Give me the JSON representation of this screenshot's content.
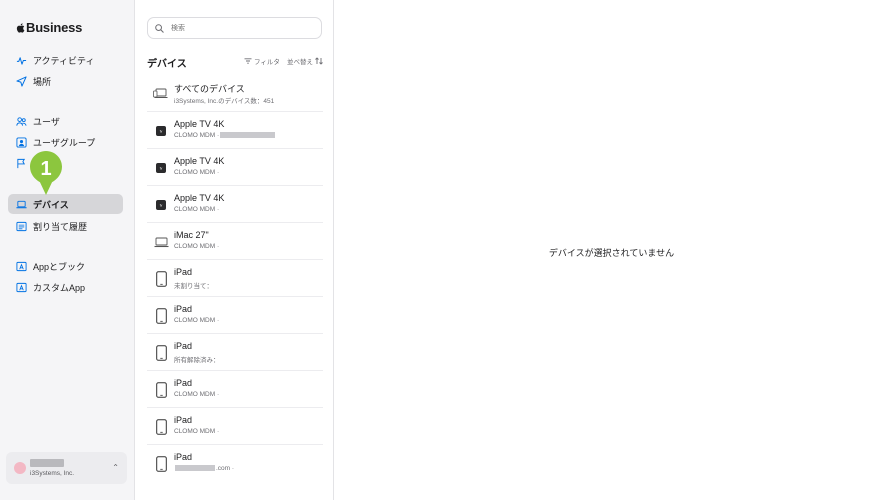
{
  "sidebar": {
    "brand": "Business",
    "items": [
      {
        "label": "アクティビティ",
        "icon": "activity-icon"
      },
      {
        "label": "場所",
        "icon": "location-arrow-icon"
      },
      {
        "label": "ユーザ",
        "icon": "users-icon"
      },
      {
        "label": "ユーザグループ",
        "icon": "user-group-icon"
      },
      {
        "label": "",
        "icon": "flag-icon"
      },
      {
        "label": "デバイス",
        "icon": "laptop-icon",
        "active": true
      },
      {
        "label": "割り当て履歴",
        "icon": "list-icon"
      },
      {
        "label": "Appとブック",
        "icon": "app-store-icon"
      },
      {
        "label": "カスタムApp",
        "icon": "custom-app-icon"
      }
    ],
    "account": {
      "org": "i3Systems, Inc."
    }
  },
  "callout": {
    "number": "1",
    "color": "#8cc63e"
  },
  "list": {
    "search_placeholder": "検索",
    "title": "デバイス",
    "filter_label": "フィルタ",
    "sort_label": "並べ替え",
    "rows": [
      {
        "name": "すべてのデバイス",
        "sub": "i3Systems, Inc.のデバイス数：451",
        "icon": "all-devices-icon"
      },
      {
        "name": "Apple TV 4K",
        "sub": "CLOMO MDM ·",
        "icon": "apple-tv-icon"
      },
      {
        "name": "Apple TV 4K",
        "sub": "CLOMO MDM ·",
        "icon": "apple-tv-icon"
      },
      {
        "name": "Apple TV 4K",
        "sub": "CLOMO MDM ·",
        "icon": "apple-tv-icon"
      },
      {
        "name": "iMac 27\"",
        "sub": "CLOMO MDM ·",
        "icon": "imac-icon"
      },
      {
        "name": "iPad",
        "sub": "未割り当て：",
        "icon": "ipad-icon"
      },
      {
        "name": "iPad",
        "sub": "CLOMO MDM ·",
        "icon": "ipad-icon"
      },
      {
        "name": "iPad",
        "sub": "所有解除済み：",
        "icon": "ipad-icon"
      },
      {
        "name": "iPad",
        "sub": "CLOMO MDM ·",
        "icon": "ipad-icon"
      },
      {
        "name": "iPad",
        "sub": "CLOMO MDM ·",
        "icon": "ipad-icon"
      },
      {
        "name": "iPad",
        "sub": ".com ·",
        "icon": "ipad-icon"
      }
    ]
  },
  "detail": {
    "empty_message": "デバイスが選択されていません"
  },
  "colors": {
    "accent": "#0071e3",
    "sidebar_bg": "#f5f5f7",
    "active_bg": "#d6d6d9"
  }
}
